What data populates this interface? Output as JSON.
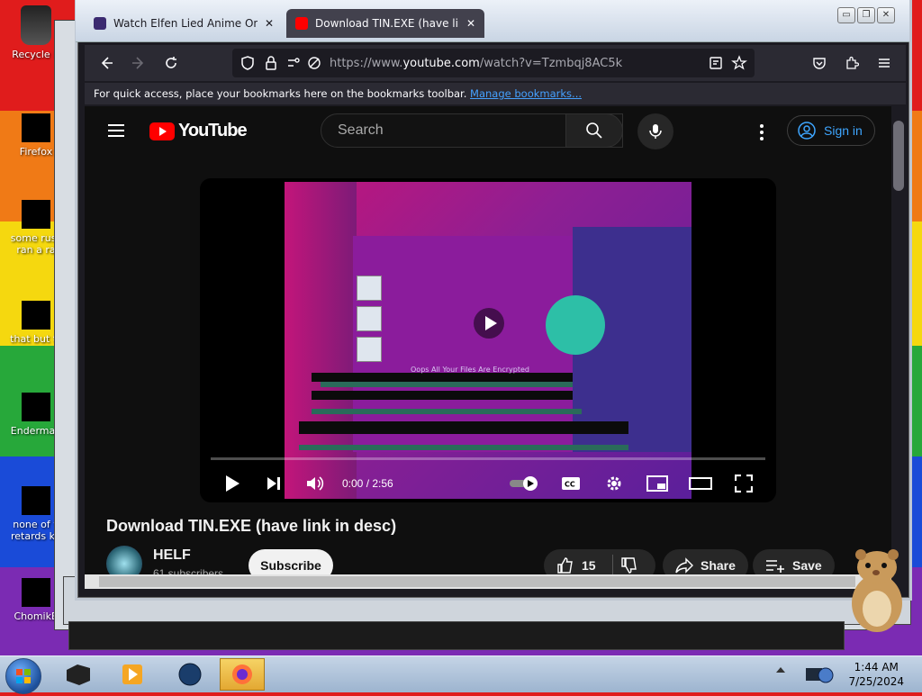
{
  "desktop": {
    "icons": [
      {
        "label": "Recycle B",
        "name": "recycle-bin"
      },
      {
        "label": "Firefox",
        "name": "firefox-shortcut"
      },
      {
        "label": "some russ\nran a ra",
        "name": "file-shortcut-1"
      },
      {
        "label": "that but ts",
        "name": "file-shortcut-2"
      },
      {
        "label": "Enderman",
        "name": "enderman-shortcut"
      },
      {
        "label": "none of y\nretards kn",
        "name": "file-shortcut-3"
      },
      {
        "label": "ChomikB",
        "name": "chomik-shortcut"
      }
    ]
  },
  "browser": {
    "tabs": [
      {
        "title": "Watch Elfen Lied Anime Online",
        "active": false,
        "favicon_color": "#3b2a70"
      },
      {
        "title": "Download TIN.EXE (have link in",
        "active": true,
        "favicon_color": "#ff0000"
      }
    ],
    "tab_close_glyph": "✕",
    "url": {
      "prefix": "https://www.",
      "domain": "youtube.com",
      "path": "/watch?v=Tzmbqj8AC5k"
    },
    "bookmarks_hint": "For quick access, place your bookmarks here on the bookmarks toolbar.",
    "bookmarks_link": "Manage bookmarks...",
    "window_controls": [
      "▭",
      "❐",
      "✕"
    ]
  },
  "youtube": {
    "brand": "YouTube",
    "search_placeholder": "Search",
    "sign_in": "Sign in",
    "player": {
      "time": "0:00 / 2:56",
      "progress": 0.0,
      "overlay_text": "Oops All Your Files Are Encrypted"
    },
    "video": {
      "title": "Download TIN.EXE (have link in desc)",
      "channel": "HELF",
      "subscribers": "61 subscribers",
      "subscribe_label": "Subscribe",
      "likes": "15",
      "share_label": "Share",
      "save_label": "Save"
    }
  },
  "taskbar": {
    "clock_time": "1:44 AM",
    "clock_date": "7/25/2024"
  },
  "colors": {
    "yt_red": "#ff0000",
    "link_blue": "#3ea6ff",
    "firefox_dark": "#1c1b22"
  }
}
